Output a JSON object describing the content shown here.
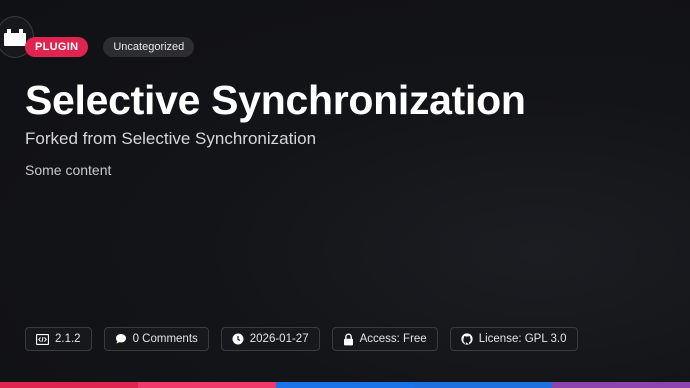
{
  "badges": {
    "type": "PLUGIN",
    "category": "Uncategorized"
  },
  "title": "Selective Synchronization",
  "subtitle": "Forked from Selective Synchronization",
  "content": "Some content",
  "meta": {
    "version": "2.1.2",
    "comments": "0 Comments",
    "date": "2026-01-27",
    "access": "Access: Free",
    "license": "License: GPL 3.0"
  },
  "colors": {
    "plugin_badge": "#e02450",
    "bar_segments": [
      "#e02450",
      "#f0386b",
      "#1a73e8",
      "#1e6fe0",
      "#8e44ad"
    ]
  },
  "icons": {
    "plugin": "plugin-icon",
    "version": "code-icon",
    "comments": "comment-icon",
    "date": "clock-icon",
    "access": "lock-icon",
    "license": "github-icon"
  }
}
